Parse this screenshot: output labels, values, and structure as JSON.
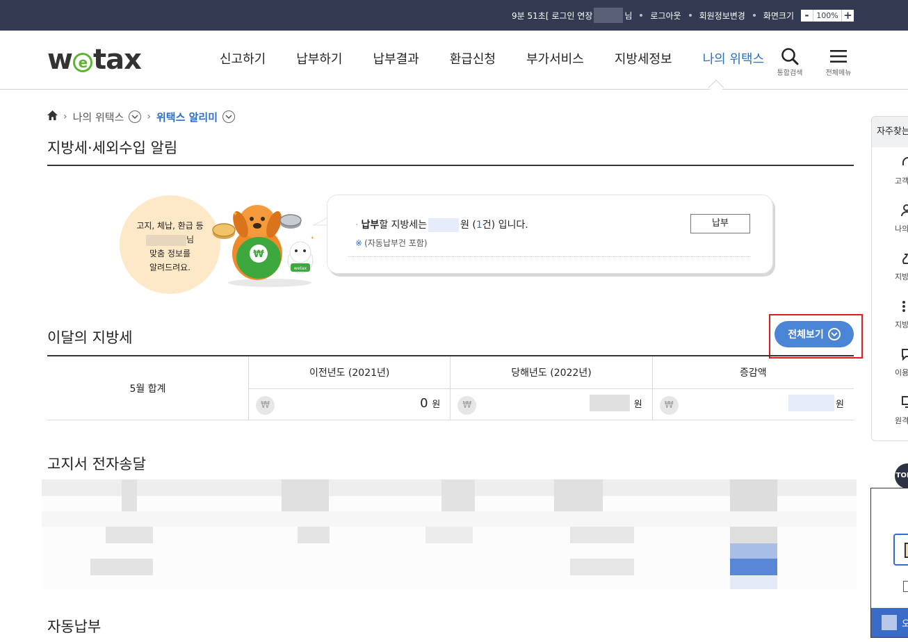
{
  "topbar": {
    "timer": "9분 51초[ 로그인 연장",
    "user_suffix": "님",
    "logout": "로그아웃",
    "member_edit": "회원정보변경",
    "screen_size": "화면크기",
    "zoom_minus": "-",
    "zoom_value": "100%",
    "zoom_plus": "+"
  },
  "header": {
    "logo_pre": "w",
    "logo_e": "e",
    "logo_post": "tax",
    "nav": [
      "신고하기",
      "납부하기",
      "납부결과",
      "환급신청",
      "부가서비스",
      "지방세정보",
      "나의 위택스"
    ],
    "search_label": "통합검색",
    "menu_label": "전체메뉴"
  },
  "breadcrumb": {
    "level1": "나의 위택스",
    "level2": "위택스 알리미"
  },
  "page_title": "지방세·세외수입 알림",
  "mascot": {
    "line1": "고지, 체납, 환급 등",
    "line2_suffix": "님",
    "line3": "맞춤 정보를",
    "line4": "알려드려요."
  },
  "bubble": {
    "bold": "납부",
    "text_a": "할 지방세는",
    "text_b": "원 (",
    "count": "1",
    "text_c": "건) 입니다.",
    "note_mark": "※",
    "note": "(자동납부건 포함)",
    "pay_button": "납부"
  },
  "this_month": {
    "title": "이달의 지방세",
    "view_all": "전체보기",
    "row_label": "5월 합계",
    "columns": [
      "이전년도 (2021년)",
      "당해년도 (2022년)",
      "증감액"
    ],
    "won_symbol": "₩",
    "prev_amount": "0",
    "unit": "원"
  },
  "notice_title": "고지서 전자송달",
  "autopay_title": "자동납부",
  "quick_menu": {
    "title": "자주찾는",
    "items": [
      "고객",
      "나의 위",
      "지방세",
      "지방세",
      "이용자",
      "원격"
    ]
  },
  "top_button": "TOP",
  "popup": {
    "bar_text": "오"
  },
  "colors": {
    "topbar": "#333a52",
    "accent": "#2a6ec9",
    "button": "#4b86d6",
    "highlight": "#e01b1b"
  }
}
